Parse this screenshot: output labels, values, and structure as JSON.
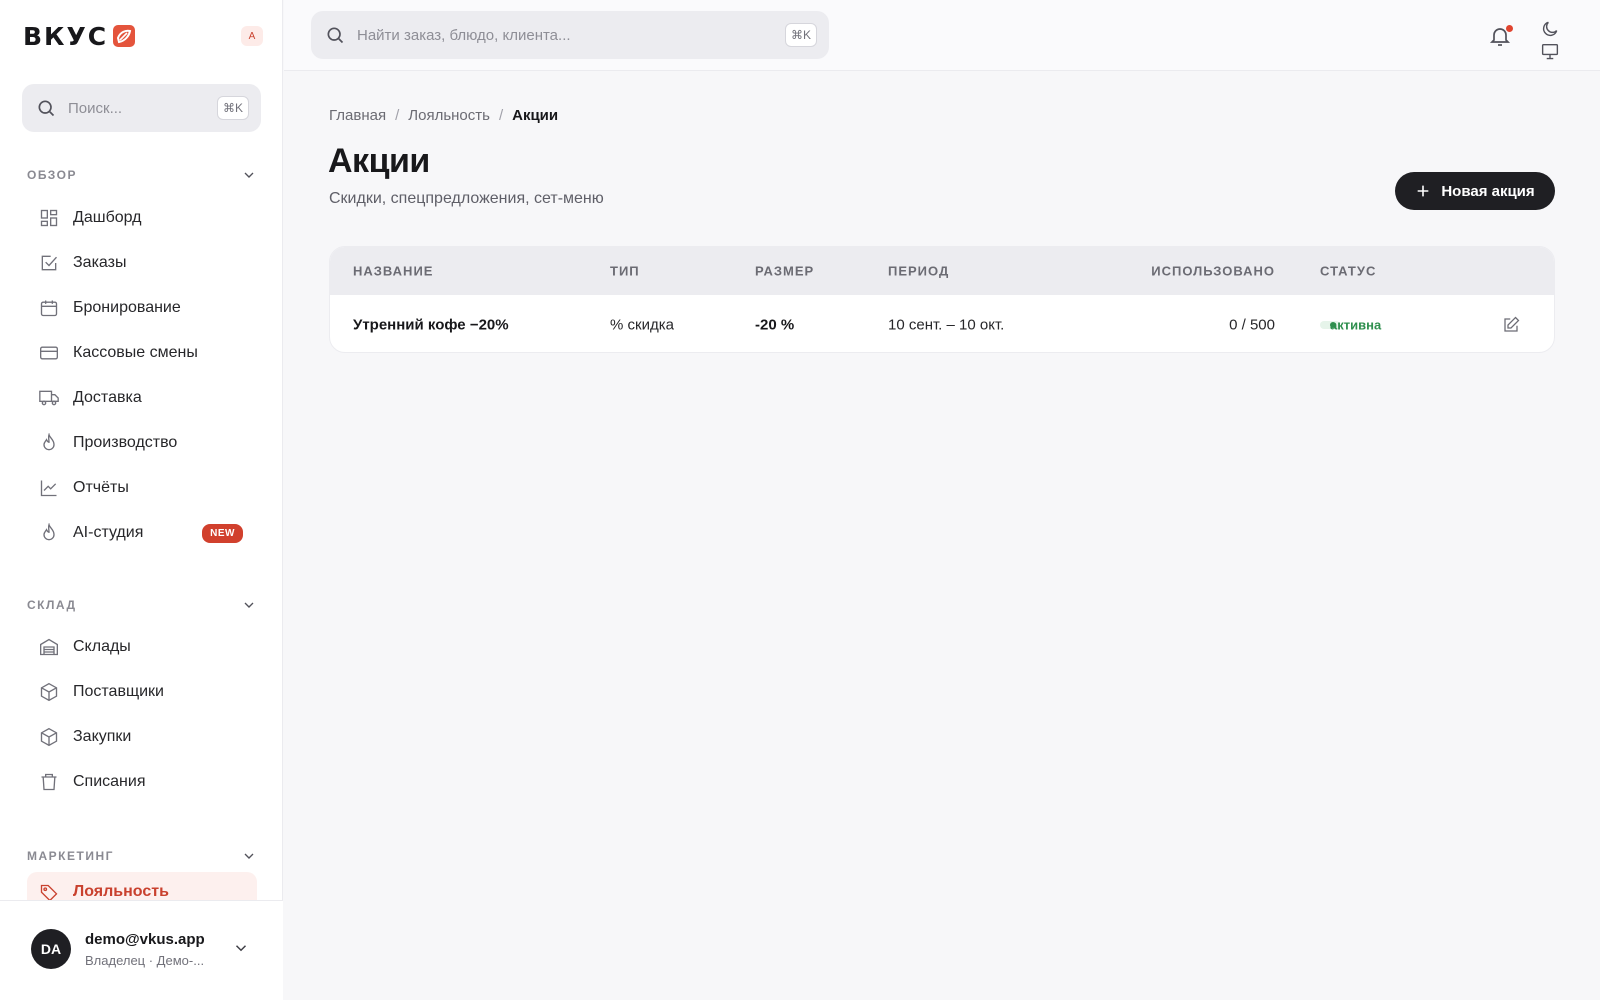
{
  "app": {
    "logo_text": "ВКУС",
    "lang_badge": "A",
    "accent": "#d1402d"
  },
  "sidebar": {
    "search_placeholder": "Поиск...",
    "search_shortcut": "⌘K",
    "sections": [
      {
        "title": "ОБЗОР"
      },
      {
        "title": "СКЛАД"
      },
      {
        "title": "МАРКЕТИНГ"
      }
    ],
    "items": [
      {
        "label": "Дашборд",
        "icon": "dashboard-icon"
      },
      {
        "label": "Заказы",
        "icon": "check-square-icon"
      },
      {
        "label": "Бронирование",
        "icon": "calendar-icon"
      },
      {
        "label": "Кассовые смены",
        "icon": "credit-card-icon"
      },
      {
        "label": "Доставка",
        "icon": "truck-icon"
      },
      {
        "label": "Производство",
        "icon": "flame-icon"
      },
      {
        "label": "Отчёты",
        "icon": "chart-line-icon"
      },
      {
        "label": "AI-студия",
        "icon": "flame-icon",
        "badge": "NEW"
      },
      {
        "label": "Склады",
        "icon": "warehouse-icon"
      },
      {
        "label": "Поставщики",
        "icon": "box-icon"
      },
      {
        "label": "Закупки",
        "icon": "box-icon"
      },
      {
        "label": "Списания",
        "icon": "trash-icon"
      },
      {
        "label": "Лояльность",
        "icon": "tag-icon",
        "active": true
      }
    ],
    "user": {
      "initials": "DA",
      "email": "demo@vkus.app",
      "role": "Владелец · Демо-..."
    }
  },
  "topbar": {
    "search_placeholder": "Найти заказ, блюдо, клиента...",
    "search_shortcut": "⌘K"
  },
  "main": {
    "breadcrumb": [
      "Главная",
      "Лояльность",
      "Акции"
    ],
    "title": "Акции",
    "subtitle": "Скидки, спецпредложения, сет-меню",
    "new_button": "Новая акция",
    "table": {
      "columns": [
        "НАЗВАНИЕ",
        "ТИП",
        "РАЗМЕР",
        "ПЕРИОД",
        "ИСПОЛЬЗОВАНО",
        "СТАТУС"
      ],
      "rows": [
        {
          "name": "Утренний кофе −20%",
          "type": "% скидка",
          "size": "-20 %",
          "period": "10 сент. – 10 окт.",
          "used": "0 / 500",
          "status": "активна"
        }
      ]
    }
  }
}
